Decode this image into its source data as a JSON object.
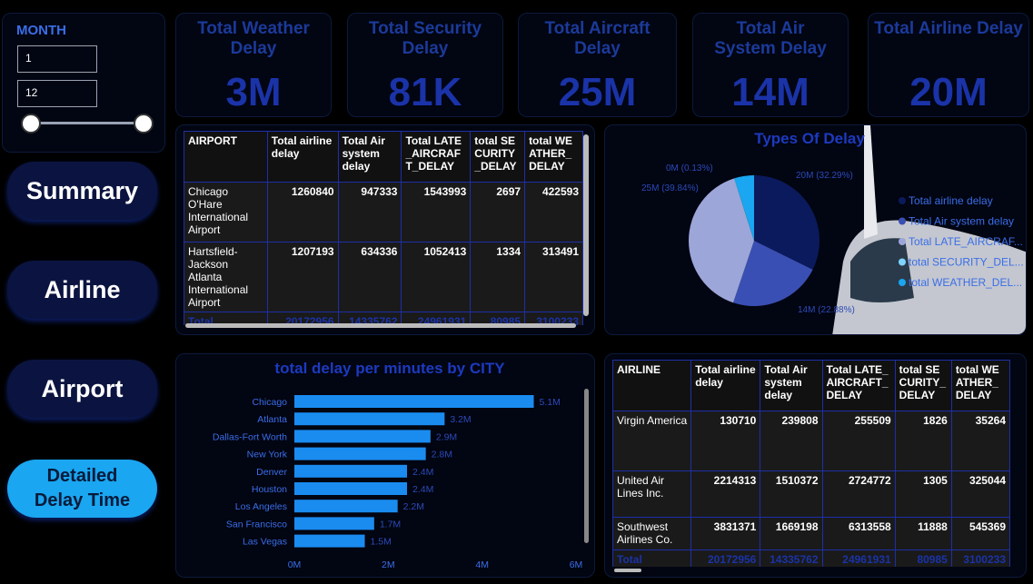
{
  "filter": {
    "label": "MONTH",
    "from": "1",
    "to": "12"
  },
  "nav": {
    "summary": "Summary",
    "airline": "Airline",
    "airport": "Airport",
    "detailed_line1": "Detailed",
    "detailed_line2": "Delay Time"
  },
  "kpis": [
    {
      "title": "Total Weather Delay",
      "value": "3M"
    },
    {
      "title": "Total Security Delay",
      "value": "81K"
    },
    {
      "title": "Total Aircraft Delay",
      "value": "25M"
    },
    {
      "title": "Total Air System Delay",
      "value": "14M"
    },
    {
      "title": "Total Airline Delay",
      "value": "20M"
    }
  ],
  "airport_table": {
    "headers": [
      "AIRPORT",
      "Total airline delay",
      "Total Air system delay",
      "Total LATE_AIRCRAFT_DELAY",
      "total SECURITY_DELAY",
      "total WEATHER_DELAY"
    ],
    "rows": [
      [
        "Chicago O'Hare International Airport",
        "1260840",
        "947333",
        "1543993",
        "2697",
        "422593"
      ],
      [
        "Hartsfield-Jackson Atlanta International Airport",
        "1207193",
        "634336",
        "1052413",
        "1334",
        "313491"
      ]
    ],
    "total": [
      "Total",
      "20172956",
      "14335762",
      "24961931",
      "80985",
      "3100233"
    ]
  },
  "airline_table": {
    "headers": [
      "AIRLINE",
      "Total airline delay",
      "Total Air system delay",
      "Total LATE_AIRCRAFT_DELAY",
      "total SECURITY_DELAY",
      "total WEATHER_DELAY"
    ],
    "rows": [
      [
        "Virgin America",
        "130710",
        "239808",
        "255509",
        "1826",
        "35264"
      ],
      [
        "United Air Lines Inc.",
        "2214313",
        "1510372",
        "2724772",
        "1305",
        "325044"
      ],
      [
        "Southwest Airlines Co.",
        "3831371",
        "1669198",
        "6313558",
        "11888",
        "545369"
      ]
    ],
    "total": [
      "Total",
      "20172956",
      "14335762",
      "24961931",
      "80985",
      "3100233"
    ]
  },
  "pie": {
    "title": "Types Of Delay",
    "slices": [
      {
        "name": "Total airline delay",
        "label": "20M (32.29%)",
        "pct": 32.29,
        "color": "#0b1a5c"
      },
      {
        "name": "Total Air system delay",
        "label": "14M (22.88%)",
        "pct": 22.88,
        "color": "#3a4fb3"
      },
      {
        "name": "Total LATE_AIRCRAF...",
        "label": "25M (39.84%)",
        "pct": 39.84,
        "color": "#9da6d8"
      },
      {
        "name": "total SECURITY_DEL...",
        "label": "0M (0.13%)",
        "pct": 0.13,
        "color": "#7fd3ff"
      },
      {
        "name": "total WEATHER_DEL...",
        "label": "",
        "pct": 4.86,
        "color": "#1aa6f0"
      }
    ]
  },
  "chart_data": {
    "type": "bar",
    "title": "total delay per minutes by CITY",
    "categories": [
      "Chicago",
      "Atlanta",
      "Dallas-Fort Worth",
      "New York",
      "Denver",
      "Houston",
      "Los Angeles",
      "San Francisco",
      "Las Vegas"
    ],
    "values": [
      5.1,
      3.2,
      2.9,
      2.8,
      2.4,
      2.4,
      2.2,
      1.7,
      1.5
    ],
    "labels": [
      "5.1M",
      "3.2M",
      "2.9M",
      "2.8M",
      "2.4M",
      "2.4M",
      "2.2M",
      "1.7M",
      "1.5M"
    ],
    "ticks": [
      "0M",
      "2M",
      "4M",
      "6M"
    ],
    "xlim": [
      0,
      6
    ],
    "bar_color": "#1a8cf0"
  }
}
